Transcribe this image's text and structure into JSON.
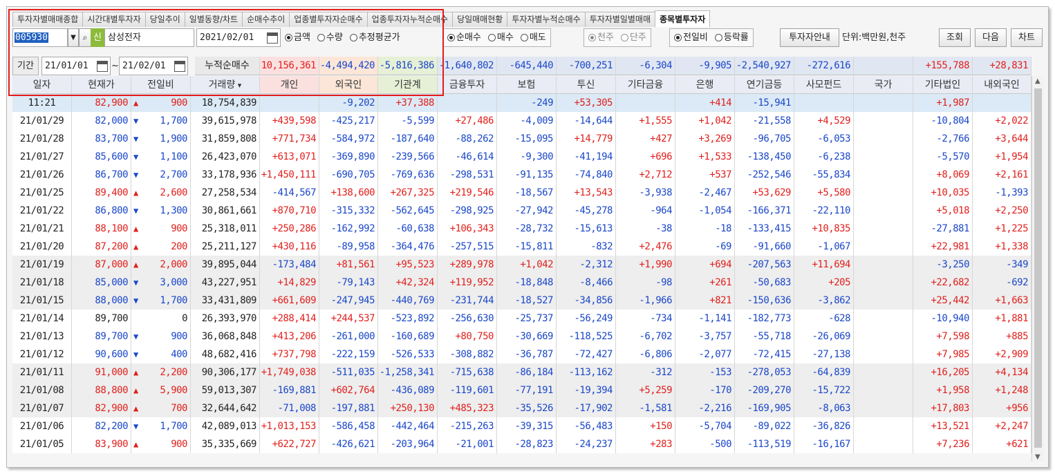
{
  "tabs": [
    "투자자별매매종합",
    "시간대별투자자",
    "당일추이",
    "일별동향/차트",
    "순매수추이",
    "업종별투자자순매수",
    "업종투자자누적순매수",
    "당일매매현황",
    "투자자별누적순매수",
    "투자자별일별매매",
    "종목별투자자"
  ],
  "active_tab": 10,
  "toolbar": {
    "code": "005930",
    "sin_label": "신",
    "stock_name": "삼성전자",
    "date": "2021/02/01",
    "measure": {
      "options": [
        "금액",
        "수량",
        "추정평균가"
      ],
      "selected": 0
    },
    "trade": {
      "options": [
        "순매수",
        "매수",
        "매도"
      ],
      "selected": 0
    },
    "unit_scale": {
      "options": [
        "천주",
        "단주"
      ],
      "selected": 0
    },
    "compare": {
      "options": [
        "전일비",
        "등락률"
      ],
      "selected": 0
    },
    "guide_button": "투자자안내",
    "unit_text": "단위:백만원,천주",
    "query_button": "조회",
    "next_button": "다음",
    "chart_button": "차트"
  },
  "period": {
    "label": "기간",
    "from": "21/01/01",
    "separator": "~",
    "to": "21/02/01",
    "sum_label": "누적순매수",
    "sums": [
      "10,156,361",
      "-4,494,420",
      "-5,816,386",
      "-1,640,802",
      "-645,440",
      "-700,251",
      "-6,304",
      "-9,905",
      "-2,540,927",
      "-272,616",
      "",
      "+155,788",
      "+28,831"
    ]
  },
  "columns": [
    "일자",
    "현재가",
    "전일비",
    "거래량",
    "개인",
    "외국인",
    "기관계",
    "금융투자",
    "보험",
    "투신",
    "기타금융",
    "은행",
    "연기금등",
    "사모펀드",
    "국가",
    "기타법인",
    "내외국인"
  ],
  "rows": [
    {
      "date": "11:21",
      "price": "82,900",
      "dir": "up",
      "chg": "900",
      "vol": "18,754,839",
      "vals": [
        "",
        "-9,202",
        "+37,388",
        "",
        "-249",
        "+53,305",
        "",
        "+414",
        "-15,941",
        "",
        "",
        "+1,987",
        ""
      ]
    },
    {
      "date": "21/01/29",
      "price": "82,000",
      "dir": "dn",
      "chg": "1,700",
      "vol": "39,615,978",
      "vals": [
        "+439,598",
        "-425,217",
        "-5,599",
        "+27,486",
        "-4,009",
        "-14,644",
        "+1,555",
        "+1,042",
        "-21,558",
        "+4,529",
        "",
        "-10,804",
        "+2,022"
      ]
    },
    {
      "date": "21/01/28",
      "price": "83,700",
      "dir": "dn",
      "chg": "1,900",
      "vol": "31,859,808",
      "vals": [
        "+771,734",
        "-584,972",
        "-187,640",
        "-88,262",
        "-15,095",
        "+14,779",
        "+427",
        "+3,269",
        "-96,705",
        "-6,053",
        "",
        "-2,766",
        "+3,644"
      ]
    },
    {
      "date": "21/01/27",
      "price": "85,600",
      "dir": "dn",
      "chg": "1,100",
      "vol": "26,423,070",
      "vals": [
        "+613,071",
        "-369,890",
        "-239,566",
        "-46,614",
        "-9,300",
        "-41,194",
        "+696",
        "+1,533",
        "-138,450",
        "-6,238",
        "",
        "-5,570",
        "+1,954"
      ]
    },
    {
      "date": "21/01/26",
      "price": "86,700",
      "dir": "dn",
      "chg": "2,700",
      "vol": "33,178,936",
      "vals": [
        "+1,450,111",
        "-690,705",
        "-769,636",
        "-298,531",
        "-91,135",
        "-74,840",
        "+2,712",
        "+537",
        "-252,546",
        "-55,834",
        "",
        "+8,069",
        "+2,161"
      ]
    },
    {
      "date": "21/01/25",
      "price": "89,400",
      "dir": "up",
      "chg": "2,600",
      "vol": "27,258,534",
      "vals": [
        "-414,567",
        "+138,600",
        "+267,325",
        "+219,546",
        "-18,567",
        "+13,543",
        "-3,938",
        "-2,467",
        "+53,629",
        "+5,580",
        "",
        "+10,035",
        "-1,393"
      ]
    },
    {
      "date": "21/01/22",
      "price": "86,800",
      "dir": "dn",
      "chg": "1,300",
      "vol": "30,861,661",
      "vals": [
        "+870,710",
        "-315,332",
        "-562,645",
        "-298,925",
        "-27,942",
        "-45,278",
        "-964",
        "-1,054",
        "-166,371",
        "-22,110",
        "",
        "+5,018",
        "+2,250"
      ]
    },
    {
      "date": "21/01/21",
      "price": "88,100",
      "dir": "up",
      "chg": "900",
      "vol": "25,318,011",
      "vals": [
        "+250,286",
        "-162,992",
        "-60,638",
        "+106,343",
        "-28,732",
        "-15,613",
        "-38",
        "-18",
        "-133,415",
        "+10,835",
        "",
        "-27,881",
        "+1,225"
      ]
    },
    {
      "date": "21/01/20",
      "price": "87,200",
      "dir": "up",
      "chg": "200",
      "vol": "25,211,127",
      "vals": [
        "+430,116",
        "-89,958",
        "-364,476",
        "-257,515",
        "-15,811",
        "-832",
        "+2,476",
        "-69",
        "-91,660",
        "-1,067",
        "",
        "+22,981",
        "+1,338"
      ]
    },
    {
      "date": "21/01/19",
      "price": "87,000",
      "dir": "up",
      "chg": "2,000",
      "vol": "39,895,044",
      "vals": [
        "-173,484",
        "+81,561",
        "+95,523",
        "+289,978",
        "+1,042",
        "-2,312",
        "+1,990",
        "+694",
        "-207,563",
        "+11,694",
        "",
        "-3,250",
        "-349"
      ]
    },
    {
      "date": "21/01/18",
      "price": "85,000",
      "dir": "dn",
      "chg": "3,000",
      "vol": "43,227,951",
      "vals": [
        "+14,829",
        "-79,143",
        "+42,324",
        "+119,952",
        "-18,848",
        "-8,466",
        "-98",
        "+261",
        "-50,683",
        "+205",
        "",
        "+22,682",
        "-692"
      ]
    },
    {
      "date": "21/01/15",
      "price": "88,000",
      "dir": "dn",
      "chg": "1,700",
      "vol": "33,431,809",
      "vals": [
        "+661,609",
        "-247,945",
        "-440,769",
        "-231,744",
        "-18,527",
        "-34,856",
        "-1,966",
        "+821",
        "-150,636",
        "-3,862",
        "",
        "+25,442",
        "+1,663"
      ]
    },
    {
      "date": "21/01/14",
      "price": "89,700",
      "dir": "none",
      "chg": "0",
      "vol": "26,393,970",
      "vals": [
        "+288,414",
        "+244,537",
        "-523,892",
        "-256,630",
        "-25,737",
        "-56,249",
        "-734",
        "-1,141",
        "-182,773",
        "-628",
        "",
        "-10,940",
        "+1,881"
      ]
    },
    {
      "date": "21/01/13",
      "price": "89,700",
      "dir": "dn",
      "chg": "900",
      "vol": "36,068,848",
      "vals": [
        "+413,206",
        "-261,000",
        "-160,689",
        "+80,750",
        "-30,669",
        "-118,525",
        "-6,702",
        "-3,757",
        "-55,718",
        "-26,069",
        "",
        "+7,598",
        "+885"
      ]
    },
    {
      "date": "21/01/12",
      "price": "90,600",
      "dir": "dn",
      "chg": "400",
      "vol": "48,682,416",
      "vals": [
        "+737,798",
        "-222,159",
        "-526,533",
        "-308,882",
        "-36,787",
        "-72,427",
        "-6,806",
        "-2,077",
        "-72,415",
        "-27,138",
        "",
        "+7,985",
        "+2,909"
      ]
    },
    {
      "date": "21/01/11",
      "price": "91,000",
      "dir": "up",
      "chg": "2,200",
      "vol": "90,306,177",
      "vals": [
        "+1,749,038",
        "-511,035",
        "-1,258,341",
        "-715,638",
        "-86,184",
        "-113,162",
        "-312",
        "-153",
        "-278,053",
        "-64,839",
        "",
        "+16,205",
        "+4,134"
      ]
    },
    {
      "date": "21/01/08",
      "price": "88,800",
      "dir": "up",
      "chg": "5,900",
      "vol": "59,013,307",
      "vals": [
        "-169,881",
        "+602,764",
        "-436,089",
        "-119,601",
        "-77,191",
        "-19,394",
        "+5,259",
        "-170",
        "-209,270",
        "-15,722",
        "",
        "+1,958",
        "+1,248"
      ]
    },
    {
      "date": "21/01/07",
      "price": "82,900",
      "dir": "up",
      "chg": "700",
      "vol": "32,644,642",
      "vals": [
        "-71,008",
        "-197,881",
        "+250,130",
        "+485,323",
        "-35,526",
        "-17,902",
        "-1,581",
        "-2,216",
        "-169,905",
        "-8,063",
        "",
        "+17,803",
        "+956"
      ]
    },
    {
      "date": "21/01/06",
      "price": "82,200",
      "dir": "dn",
      "chg": "1,700",
      "vol": "42,089,013",
      "vals": [
        "+1,013,153",
        "-586,458",
        "-442,464",
        "-215,263",
        "-39,315",
        "-56,483",
        "+150",
        "-5,704",
        "-89,022",
        "-36,826",
        "",
        "+13,521",
        "+2,247"
      ]
    },
    {
      "date": "21/01/05",
      "price": "83,900",
      "dir": "up",
      "chg": "900",
      "vol": "35,335,669",
      "vals": [
        "+622,727",
        "-426,621",
        "-203,964",
        "-21,001",
        "-28,823",
        "-24,237",
        "+283",
        "-500",
        "-113,519",
        "-16,167",
        "",
        "+7,236",
        "+621"
      ]
    }
  ],
  "colors": {
    "up": "#e0201c",
    "down": "#1a47c9",
    "highlight_border": "#e51a1a"
  }
}
